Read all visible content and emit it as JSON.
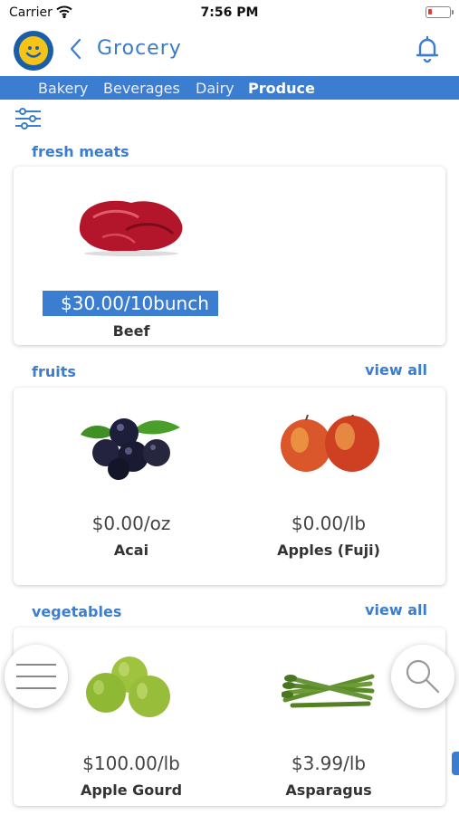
{
  "status_bar": {
    "carrier": "Carrier",
    "time": "7:56 PM"
  },
  "header": {
    "title": "Grocery"
  },
  "tabs": [
    {
      "label": "Bakery",
      "active": false
    },
    {
      "label": "Beverages",
      "active": false
    },
    {
      "label": "Dairy",
      "active": false
    },
    {
      "label": "Produce",
      "active": true
    }
  ],
  "sections": [
    {
      "title": "fresh meats",
      "view_all": "",
      "items": [
        {
          "price": "$30.00/10bunch",
          "name": "Beef",
          "image": "beef-image"
        }
      ]
    },
    {
      "title": "fruits",
      "view_all": "view all",
      "items": [
        {
          "price": "$0.00/oz",
          "name": "Acai",
          "image": "acai-image"
        },
        {
          "price": "$0.00/lb",
          "name": "Apples (Fuji)",
          "image": "apples-image"
        }
      ]
    },
    {
      "title": "vegetables",
      "view_all": "view all",
      "items": [
        {
          "price": "$100.00/lb",
          "name": "Apple Gourd",
          "image": "apple-gourd-image"
        },
        {
          "price": "$3.99/lb",
          "name": "Asparagus",
          "image": "asparagus-image"
        }
      ]
    }
  ],
  "colors": {
    "accent": "#3b7dd0",
    "logo_blue": "#1b5ea8",
    "logo_yellow": "#f6c419"
  },
  "icons": [
    "wifi-icon",
    "battery-icon",
    "back-chevron-icon",
    "bell-icon",
    "filter-icon",
    "menu-icon",
    "search-icon"
  ]
}
